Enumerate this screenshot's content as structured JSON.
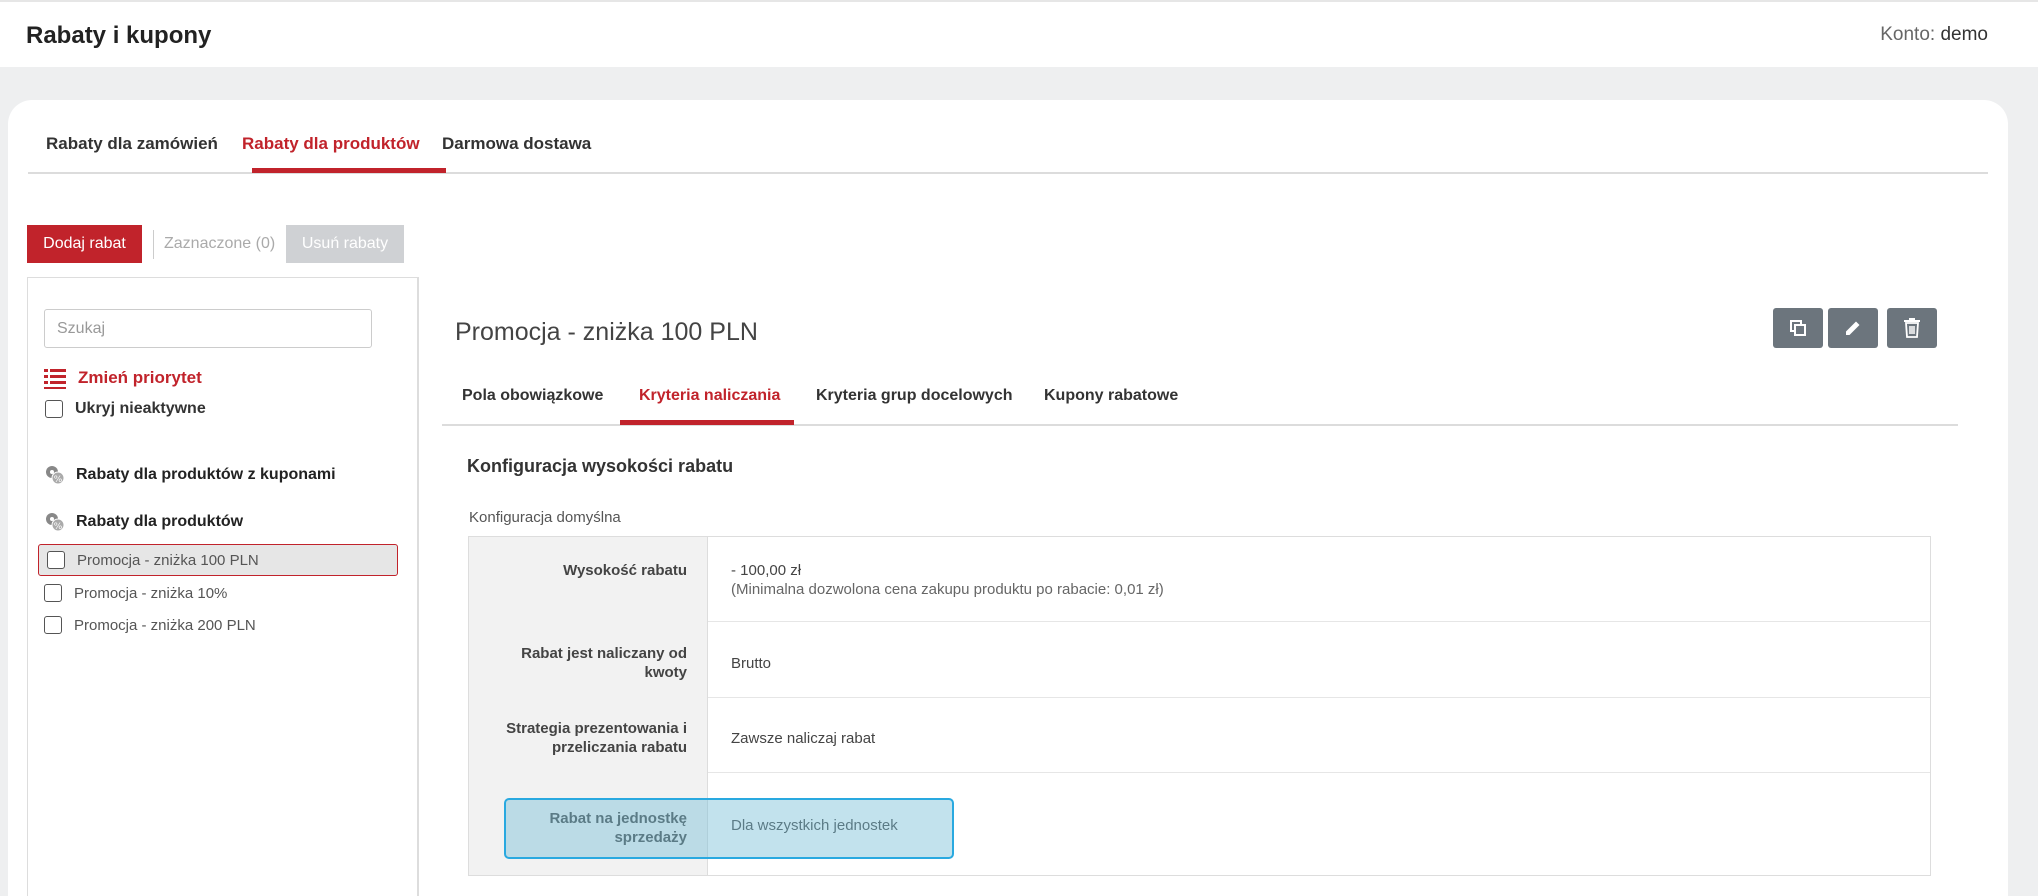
{
  "header": {
    "title": "Rabaty i kupony",
    "account_label": "Konto:",
    "account_user": "demo"
  },
  "main_tabs": [
    {
      "label": "Rabaty dla zamówień",
      "active": false
    },
    {
      "label": "Rabaty dla produktów",
      "active": true
    },
    {
      "label": "Darmowa dostawa",
      "active": false
    }
  ],
  "toolbar": {
    "add_label": "Dodaj rabat",
    "selected_label": "Zaznaczone (0)",
    "remove_label": "Usuń rabaty"
  },
  "sidebar": {
    "search_placeholder": "Szukaj",
    "priority_label": "Zmień priorytet",
    "hide_inactive_label": "Ukryj nieaktywne",
    "groups": [
      {
        "label": "Rabaty dla produktów z kuponami",
        "icon": "discount-tags-icon"
      },
      {
        "label": "Rabaty dla produktów",
        "icon": "discount-tags-icon"
      }
    ],
    "items": [
      {
        "label": "Promocja - zniżka 100 PLN",
        "selected": true
      },
      {
        "label": "Promocja - zniżka 10%",
        "selected": false
      },
      {
        "label": "Promocja - zniżka 200 PLN",
        "selected": false
      }
    ]
  },
  "detail": {
    "title": "Promocja - zniżka 100 PLN",
    "actions": [
      {
        "name": "copy-icon"
      },
      {
        "name": "pencil-icon"
      },
      {
        "name": "trash-icon"
      }
    ],
    "tabs": [
      {
        "label": "Pola obowiązkowe",
        "active": false
      },
      {
        "label": "Kryteria naliczania",
        "active": true
      },
      {
        "label": "Kryteria grup docelowych",
        "active": false
      },
      {
        "label": "Kupony rabatowe",
        "active": false
      }
    ],
    "section_title": "Konfiguracja wysokości rabatu",
    "section_subtitle": "Konfiguracja domyślna",
    "rows": [
      {
        "label_l1": "Wysokość rabatu",
        "label_l2": "",
        "value": "- 100,00 zł",
        "note": "(Minimalna dozwolona cena zakupu produktu po rabacie: 0,01 zł)"
      },
      {
        "label_l1": "Rabat jest naliczany od",
        "label_l2": "kwoty",
        "value": "Brutto",
        "note": ""
      },
      {
        "label_l1": "Strategia prezentowania i",
        "label_l2": "przeliczania rabatu",
        "value": "Zawsze naliczaj rabat",
        "note": ""
      },
      {
        "label_l1": "Rabat na jednostkę",
        "label_l2": "sprzedaży",
        "value": "Dla wszystkich jednostek",
        "note": ""
      }
    ]
  },
  "colors": {
    "accent": "#c1232b",
    "icon_button": "#6c757d",
    "highlight_border": "#29a9e0"
  }
}
